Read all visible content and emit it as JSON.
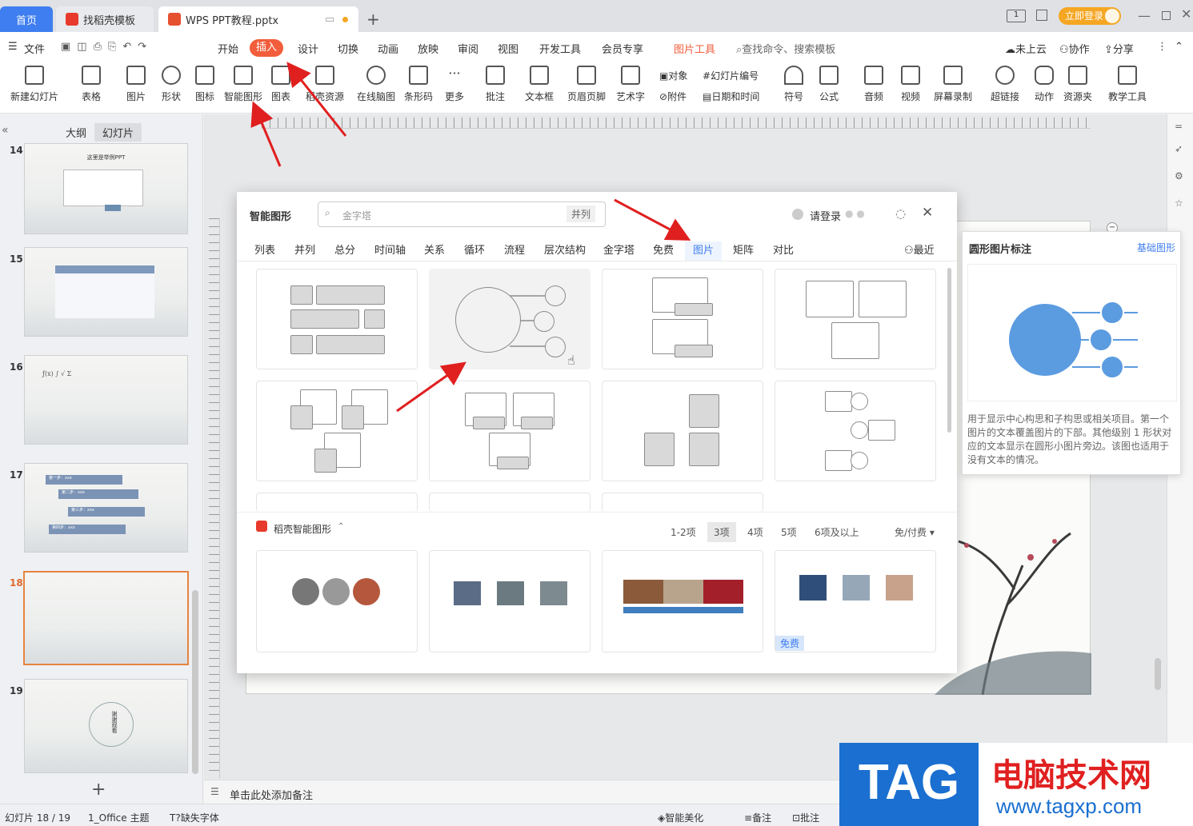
{
  "tabs": {
    "home": "首页",
    "template": "找稻壳模板",
    "file": "WPS PPT教程.pptx",
    "login": "立即登录"
  },
  "menu": {
    "file": "文件",
    "start": "开始",
    "insert": "插入",
    "design": "设计",
    "switch": "切换",
    "animation": "动画",
    "play": "放映",
    "review": "审阅",
    "view": "视图",
    "devtools": "开发工具",
    "member": "会员专享",
    "picture_tools": "图片工具",
    "search": "查找命令、搜索模板",
    "cloud": "未上云",
    "collab": "协作",
    "share": "分享"
  },
  "ribbon": [
    "新建幻灯片",
    "表格",
    "图片",
    "形状",
    "图标",
    "智能图形",
    "图表",
    "稻壳资源",
    "在线脑图",
    "条形码",
    "更多",
    "批注",
    "文本框",
    "页眉页脚",
    "艺术字",
    "符号",
    "公式",
    "音频",
    "视频",
    "屏幕录制",
    "超链接",
    "动作",
    "资源夹",
    "教学工具"
  ],
  "ribbon_small": {
    "object": "对象",
    "slide_number": "幻灯片编号",
    "attachment": "附件",
    "datetime": "日期和时间"
  },
  "sidebar": {
    "outline": "大纲",
    "slides": "幻灯片",
    "thumbs": [
      {
        "num": "14",
        "title": "这里是举例PPT"
      },
      {
        "num": "15"
      },
      {
        "num": "16"
      },
      {
        "num": "17",
        "steps": [
          "第一步：xxx",
          "第二步：xxx",
          "第三步：xxx",
          "第四步：xxx"
        ]
      },
      {
        "num": "18"
      },
      {
        "num": "19",
        "title": "谢谢观看"
      }
    ]
  },
  "dialog": {
    "title": "智能图形",
    "search_placeholder": "金字塔",
    "search_tag": "并列",
    "login": "请登录",
    "categories": [
      "列表",
      "并列",
      "总分",
      "时间轴",
      "关系",
      "循环",
      "流程",
      "层次结构",
      "金字塔",
      "免费",
      "图片",
      "矩阵",
      "对比"
    ],
    "recent": "最近",
    "docer_label": "稻壳智能图形",
    "filters": [
      "1-2项",
      "3项",
      "4项",
      "5项",
      "6项及以上"
    ],
    "price_filter": "免/付费",
    "free_badge": "免费"
  },
  "preview": {
    "title": "圆形图片标注",
    "link": "基础图形",
    "desc": "用于显示中心构思和子构思或相关项目。第一个图片的文本覆盖图片的下部。其他级别 1 形状对应的文本显示在圆形小图片旁边。该图也适用于没有文本的情况。"
  },
  "notes": {
    "placeholder": "单击此处添加备注"
  },
  "status": {
    "slide": "幻灯片 18 / 19",
    "theme": "1_Office 主题",
    "font": "缺失字体",
    "beautify": "智能美化",
    "notes": "备注",
    "comment": "批注"
  },
  "watermark": {
    "tag": "TAG",
    "site": "电脑技术网",
    "url": "www.tagxp.com"
  },
  "colors": {
    "accent": "#3f7ef0",
    "insert": "#f25d3b",
    "arrow": "#e01f1f",
    "preview_blue": "#5b9be0"
  }
}
